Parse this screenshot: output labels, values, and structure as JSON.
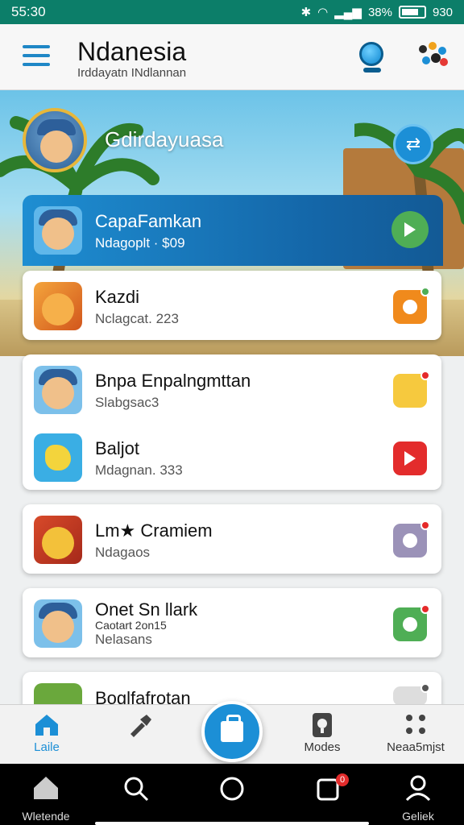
{
  "status_bar": {
    "time": "55:30",
    "battery_text": "38%",
    "right_text": "930"
  },
  "header": {
    "title": "Ndanesia",
    "subtitle": "Irddayatn INdlannan"
  },
  "hero": {
    "name": "Gdirdayuasa"
  },
  "featured": {
    "title": "CapaFamkan",
    "sub": "Ndagoplt · $09"
  },
  "cards": [
    {
      "rows": [
        {
          "title": "Kazdi",
          "sub": "Nclagcat. 223",
          "btn_color": "#f08a1c"
        }
      ]
    },
    {
      "rows": [
        {
          "title": "Bnpa Enpalngmttan",
          "sub": "Slabgsac3",
          "btn_color": "#f6c93e"
        },
        {
          "title": "Baljot",
          "sub": "Mdagnan. 333",
          "btn_color": "#e32c2c"
        }
      ]
    },
    {
      "rows": [
        {
          "title": "Lm★ Cramiem",
          "sub": "Ndagaos",
          "btn_color": "#9b92b8"
        }
      ]
    },
    {
      "rows": [
        {
          "title": "Onet Sn llark",
          "sub": "Nelasans",
          "extra": "Caotart 2on15",
          "btn_color": "#4fae55"
        }
      ]
    },
    {
      "rows": [
        {
          "title": "Boglfafrotan",
          "sub": "",
          "btn_color": "#6f6f6f"
        }
      ]
    }
  ],
  "tabs": [
    {
      "label": "Laile"
    },
    {
      "label": ""
    },
    {
      "label": "Modes"
    },
    {
      "label": "Neaa5mjst"
    }
  ],
  "nav": [
    {
      "label": "Wletende"
    },
    {
      "label": ""
    },
    {
      "label": ""
    },
    {
      "label": ""
    },
    {
      "label": "Geliek"
    }
  ],
  "nav_badge": "0"
}
